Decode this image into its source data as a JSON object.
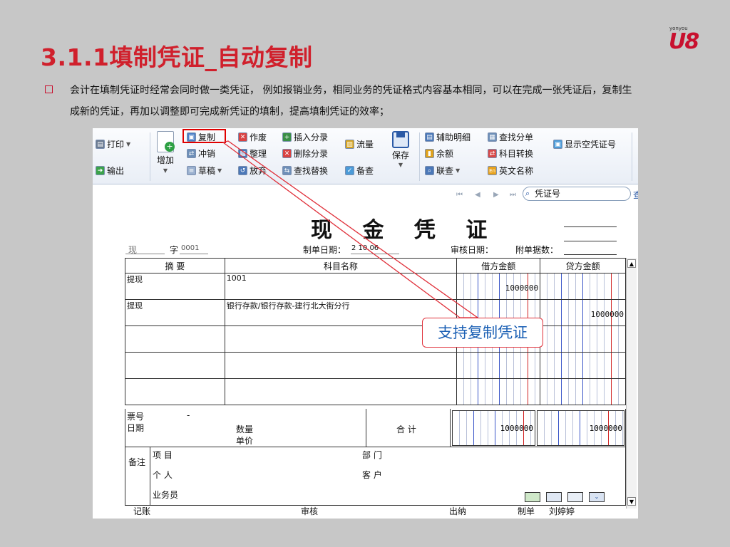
{
  "slide": {
    "title": "3.1.1填制凭证_自动复制",
    "logo_small": "yonyou",
    "logo_big": "U8",
    "paragraph": "会计在填制凭证时经常会同时做一类凭证， 例如报销业务，相同业务的凭证格式内容基本相同，可以在完成一张凭证后，复制生成新的凭证，再加以调整即可完成新凭证的填制，提高填制凭证的效率；"
  },
  "ribbon": {
    "print": "打印",
    "export": "输出",
    "add": "增加",
    "copy": "复制",
    "reverse": "冲销",
    "draft": "草稿",
    "void": "作废",
    "tidy": "整理",
    "discard": "放弃",
    "insert_entry": "插入分录",
    "delete_entry": "删除分录",
    "find_replace": "查找替换",
    "flow": "流量",
    "memo_check": "备查",
    "save": "保存",
    "aux_detail": "辅助明细",
    "balance": "余额",
    "link_query": "联查",
    "find_entry": "查找分单",
    "subject_convert": "科目转换",
    "english_name": "英文名称",
    "show_empty_no": "显示空凭证号"
  },
  "search": {
    "placeholder": "凭证号",
    "go": "查"
  },
  "voucher": {
    "title": "现 金 凭 证",
    "type": "现",
    "word_label": "字",
    "number": "0001",
    "make_date_label": "制单日期：",
    "make_date": "2 10.06",
    "audit_date_label": "审核日期：",
    "attach_label": "附单据数：",
    "headers": {
      "summary": "摘 要",
      "subject": "科目名称",
      "debit": "借方金额",
      "credit": "贷方金额"
    },
    "rows": [
      {
        "summary": "提现",
        "subject": "1001",
        "debit": "1000000",
        "credit": ""
      },
      {
        "summary": "提现",
        "subject": "银行存款/银行存款-建行北大街分行",
        "debit": "",
        "credit": "1000000"
      },
      {
        "summary": "",
        "subject": "",
        "debit": "",
        "credit": ""
      },
      {
        "summary": "",
        "subject": "",
        "debit": "",
        "credit": ""
      },
      {
        "summary": "",
        "subject": "",
        "debit": "",
        "credit": ""
      }
    ],
    "ticket_no_label": "票号",
    "ticket_no": "-",
    "date_label": "日期",
    "qty_label": "数量",
    "price_label": "单价",
    "total_label": "合 计",
    "total_debit": "1000000",
    "total_credit": "1000000",
    "remark_label": "备注",
    "project_label": "项 目",
    "person_label": "个 人",
    "salesman_label": "业务员",
    "dept_label": "部 门",
    "customer_label": "客 户",
    "footer": {
      "bookkeep": "记账",
      "audit": "审核",
      "cashier": "出纳",
      "maker_label": "制单",
      "maker": "刘婷婷"
    }
  },
  "callout": "支持复制凭证",
  "colors": {
    "title_red": "#d0202c",
    "highlight_red": "#e00000",
    "callout_text": "#1a5fb4"
  }
}
